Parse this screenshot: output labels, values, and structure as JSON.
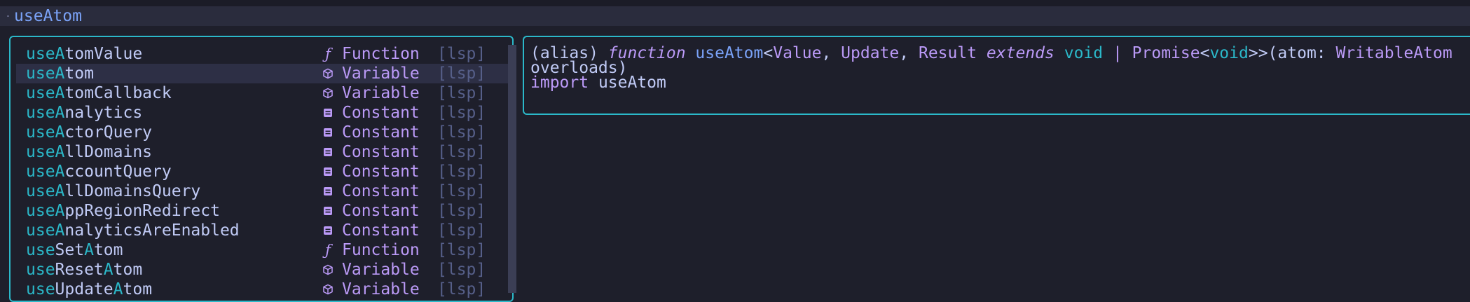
{
  "editor": {
    "typed_text": "useAtom"
  },
  "completion": {
    "items": [
      {
        "prefix": "use",
        "match": "A",
        "rest": "tomValue",
        "kind_icon": "function-icon",
        "kind": "Function",
        "source": "[lsp]",
        "selected": false
      },
      {
        "prefix": "use",
        "match": "A",
        "rest": "tom",
        "kind_icon": "variable-cube-icon",
        "kind": "Variable",
        "source": "[lsp]",
        "selected": true
      },
      {
        "prefix": "use",
        "match": "A",
        "rest": "tomCallback",
        "kind_icon": "variable-cube-icon",
        "kind": "Variable",
        "source": "[lsp]",
        "selected": false
      },
      {
        "prefix": "use",
        "match": "A",
        "rest": "nalytics",
        "kind_icon": "constant-icon",
        "kind": "Constant",
        "source": "[lsp]",
        "selected": false
      },
      {
        "prefix": "use",
        "match": "A",
        "rest": "ctorQuery",
        "kind_icon": "constant-icon",
        "kind": "Constant",
        "source": "[lsp]",
        "selected": false
      },
      {
        "prefix": "use",
        "match": "A",
        "rest": "llDomains",
        "kind_icon": "constant-icon",
        "kind": "Constant",
        "source": "[lsp]",
        "selected": false
      },
      {
        "prefix": "use",
        "match": "A",
        "rest": "ccountQuery",
        "kind_icon": "constant-icon",
        "kind": "Constant",
        "source": "[lsp]",
        "selected": false
      },
      {
        "prefix": "use",
        "match": "A",
        "rest": "llDomainsQuery",
        "kind_icon": "constant-icon",
        "kind": "Constant",
        "source": "[lsp]",
        "selected": false
      },
      {
        "prefix": "use",
        "match": "A",
        "rest": "ppRegionRedirect",
        "kind_icon": "constant-icon",
        "kind": "Constant",
        "source": "[lsp]",
        "selected": false
      },
      {
        "prefix": "use",
        "match": "A",
        "rest": "nalyticsAreEnabled",
        "kind_icon": "constant-icon",
        "kind": "Constant",
        "source": "[lsp]",
        "selected": false
      },
      {
        "prefix": "useSet",
        "match": "A",
        "rest": "tom",
        "kind_icon": "function-icon",
        "kind": "Function",
        "source": "[lsp]",
        "selected": false
      },
      {
        "prefix": "useReset",
        "match": "A",
        "rest": "tom",
        "kind_icon": "variable-cube-icon",
        "kind": "Variable",
        "source": "[lsp]",
        "selected": false
      },
      {
        "prefix": "useUpdate",
        "match": "A",
        "rest": "tom",
        "kind_icon": "variable-cube-icon",
        "kind": "Variable",
        "source": "[lsp]",
        "selected": false
      }
    ]
  },
  "documentation": {
    "line1": [
      {
        "text": "(alias) ",
        "style": "plain"
      },
      {
        "text": "function",
        "style": "kw"
      },
      {
        "text": " ",
        "style": "plain"
      },
      {
        "text": "useAtom",
        "style": "fn"
      },
      {
        "text": "<",
        "style": "plain"
      },
      {
        "text": "Value",
        "style": "tp"
      },
      {
        "text": ", ",
        "style": "plain"
      },
      {
        "text": "Update",
        "style": "tp"
      },
      {
        "text": ", ",
        "style": "plain"
      },
      {
        "text": "Result",
        "style": "tp"
      },
      {
        "text": " ",
        "style": "plain"
      },
      {
        "text": "extends",
        "style": "kw"
      },
      {
        "text": " ",
        "style": "plain"
      },
      {
        "text": "void",
        "style": "type"
      },
      {
        "text": " | ",
        "style": "tp"
      },
      {
        "text": "Promise",
        "style": "tp"
      },
      {
        "text": "<",
        "style": "plain"
      },
      {
        "text": "void",
        "style": "type"
      },
      {
        "text": ">>",
        "style": "plain"
      },
      {
        "text": "(",
        "style": "plain"
      },
      {
        "text": "atom",
        "style": "param"
      },
      {
        "text": ": ",
        "style": "plain"
      },
      {
        "text": "WritableAtom",
        "style": "tp"
      }
    ],
    "line2": "overloads)",
    "line3_keyword": "import",
    "line3_name": " useAtom"
  },
  "colors": {
    "accent": "#2bb8c9",
    "keyword": "#bb9af7",
    "function": "#7aa2f7",
    "text": "#c0caf5",
    "muted": "#565f89",
    "background": "#1e1f2b",
    "selection": "#2d2f45"
  }
}
